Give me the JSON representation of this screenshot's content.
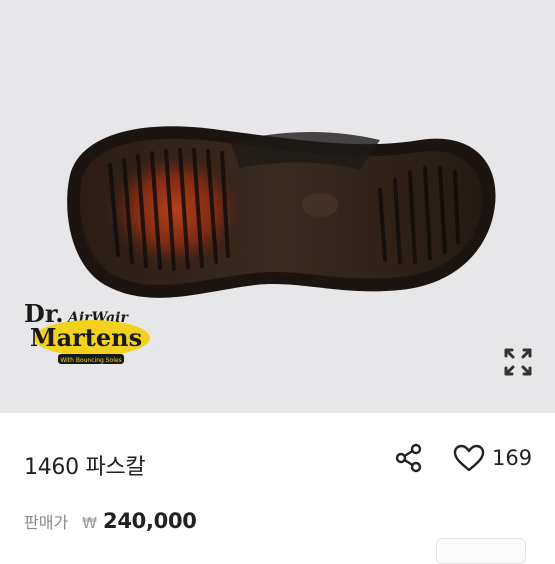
{
  "product": {
    "title": "1460 파스칼",
    "like_count": "169",
    "price_label": "판매가",
    "currency_symbol": "₩",
    "price": "240,000"
  },
  "brand_logo": {
    "line1": "Dr.",
    "line2": "AirWair",
    "line3": "Martens",
    "tagline": "With Bouncing Soles"
  },
  "icons": {
    "expand": "expand-icon",
    "share": "share-icon",
    "like": "heart-icon"
  },
  "colors": {
    "photo_background": "#e7e7e9",
    "logo_yellow": "#f2d21e",
    "text_primary": "#222222",
    "text_secondary": "#8a8a8a"
  }
}
